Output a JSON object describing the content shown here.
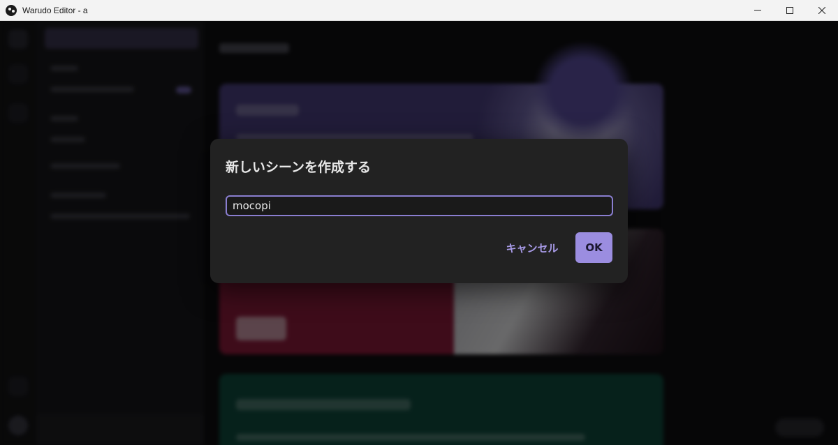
{
  "window": {
    "title": "Warudo Editor - a",
    "controls": {
      "minimize": "minimize-icon",
      "maximize": "maximize-icon",
      "close": "close-icon"
    }
  },
  "dialog": {
    "title": "新しいシーンを作成する",
    "input_value": "mocopi",
    "cancel_label": "キャンセル",
    "ok_label": "OK"
  },
  "colors": {
    "accent": "#9b8de0",
    "accent_text": "#a89be8",
    "dialog_bg": "#222222",
    "overlay": "rgba(0,0,0,0.55)"
  }
}
